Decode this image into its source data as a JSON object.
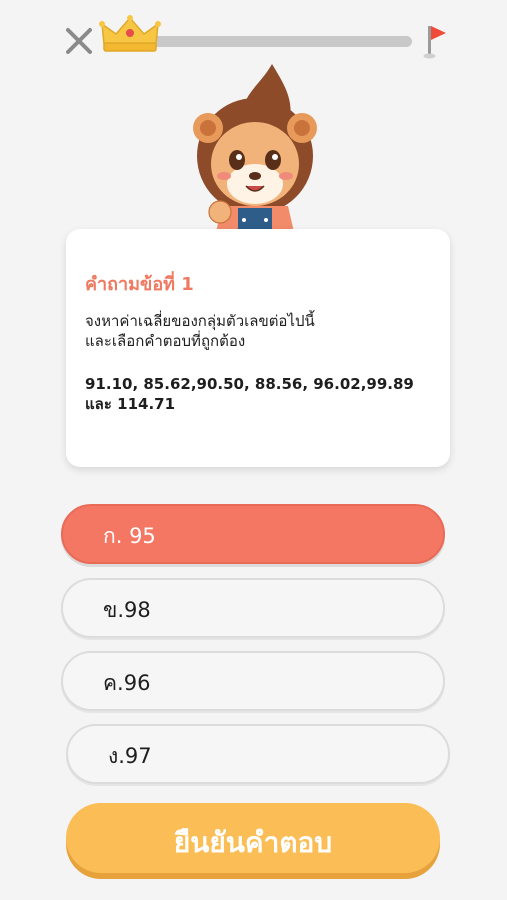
{
  "header": {
    "close_icon": "close-icon",
    "crown_icon": "crown-icon",
    "flag_icon": "flag-icon",
    "progress_fraction": 0.0
  },
  "mascot": {
    "icon": "lion-mascot"
  },
  "question": {
    "title": "คำถามข้อที่ 1",
    "text_line1": "จงหาค่าเฉลี่ยของกลุ่มตัวเลขต่อไปนี้",
    "text_line2": "และเลือกคำตอบที่ถูกต้อง",
    "numbers_line1": "91.10, 85.62,90.50, 88.56, 96.02,99.89",
    "numbers_line2": "และ 114.71"
  },
  "options": [
    {
      "label": "ก. 95",
      "selected": true
    },
    {
      "label": "ข.98",
      "selected": false
    },
    {
      "label": "ค.96",
      "selected": false
    },
    {
      "label": "ง.97",
      "selected": false
    }
  ],
  "confirm": {
    "label": "ยืนยันคำตอบ"
  },
  "colors": {
    "accent": "#f47764",
    "confirm": "#fbbd55",
    "title": "#ef7a62"
  }
}
